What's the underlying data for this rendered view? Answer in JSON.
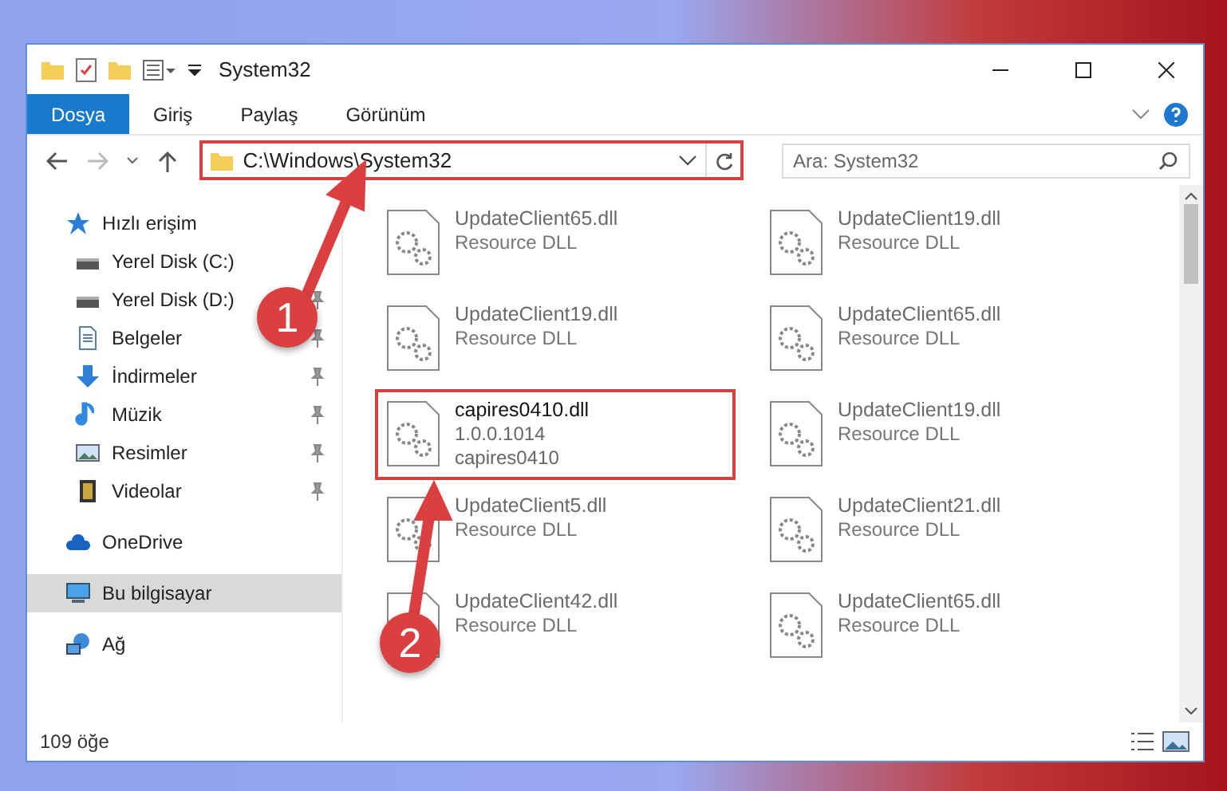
{
  "window": {
    "title": "System32"
  },
  "ribbon_tabs": [
    {
      "label": "Dosya",
      "kind": "file"
    },
    {
      "label": "Giriş",
      "kind": "tab"
    },
    {
      "label": "Paylaş",
      "kind": "tab"
    },
    {
      "label": "Görünüm",
      "kind": "tab"
    }
  ],
  "address": {
    "path": "C:\\Windows\\System32",
    "highlighted": true
  },
  "search": {
    "placeholder": "Ara: System32"
  },
  "sidebar": {
    "items": [
      {
        "label": "Hızlı erişim",
        "kind": "star",
        "selected": false,
        "children": [
          {
            "label": "Yerel Disk (C:)",
            "kind": "drive",
            "pinned": false,
            "selected": false
          },
          {
            "label": "Yerel Disk (D:)",
            "kind": "drive",
            "pinned": true,
            "selected": false
          },
          {
            "label": "Belgeler",
            "kind": "document",
            "pinned": true,
            "selected": false
          },
          {
            "label": "İndirmeler",
            "kind": "download",
            "pinned": true,
            "selected": false
          },
          {
            "label": "Müzik",
            "kind": "music",
            "pinned": true,
            "selected": false
          },
          {
            "label": "Resimler",
            "kind": "picture",
            "pinned": true,
            "selected": false
          },
          {
            "label": "Videolar",
            "kind": "video",
            "pinned": true,
            "selected": false
          }
        ]
      },
      {
        "label": "OneDrive",
        "kind": "cloud",
        "selected": false
      },
      {
        "label": "Bu bilgisayar",
        "kind": "computer",
        "selected": true
      },
      {
        "label": "Ağ",
        "kind": "network",
        "selected": false
      }
    ]
  },
  "files": [
    {
      "name": "UpdateClient65.dll",
      "details": [
        "Resource DLL"
      ],
      "faded": true,
      "highlighted": false
    },
    {
      "name": "UpdateClient19.dll",
      "details": [
        "Resource DLL"
      ],
      "faded": true,
      "highlighted": false
    },
    {
      "name": "UpdateClient19.dll",
      "details": [
        "Resource DLL"
      ],
      "faded": true,
      "highlighted": false
    },
    {
      "name": "UpdateClient65.dll",
      "details": [
        "Resource DLL"
      ],
      "faded": true,
      "highlighted": false
    },
    {
      "name": "capires0410.dll",
      "details": [
        "1.0.0.1014",
        "capires0410"
      ],
      "faded": false,
      "highlighted": true
    },
    {
      "name": "UpdateClient19.dll",
      "details": [
        "Resource DLL"
      ],
      "faded": true,
      "highlighted": false
    },
    {
      "name": "UpdateClient5.dll",
      "details": [
        "Resource DLL"
      ],
      "faded": true,
      "highlighted": false
    },
    {
      "name": "UpdateClient21.dll",
      "details": [
        "Resource DLL"
      ],
      "faded": true,
      "highlighted": false
    },
    {
      "name": "UpdateClient42.dll",
      "details": [
        "Resource DLL"
      ],
      "faded": true,
      "highlighted": false
    },
    {
      "name": "UpdateClient65.dll",
      "details": [
        "Resource DLL"
      ],
      "faded": true,
      "highlighted": false
    }
  ],
  "status_bar": {
    "count": "109 öğe"
  },
  "annotations": [
    {
      "number": "1"
    },
    {
      "number": "2"
    }
  ]
}
